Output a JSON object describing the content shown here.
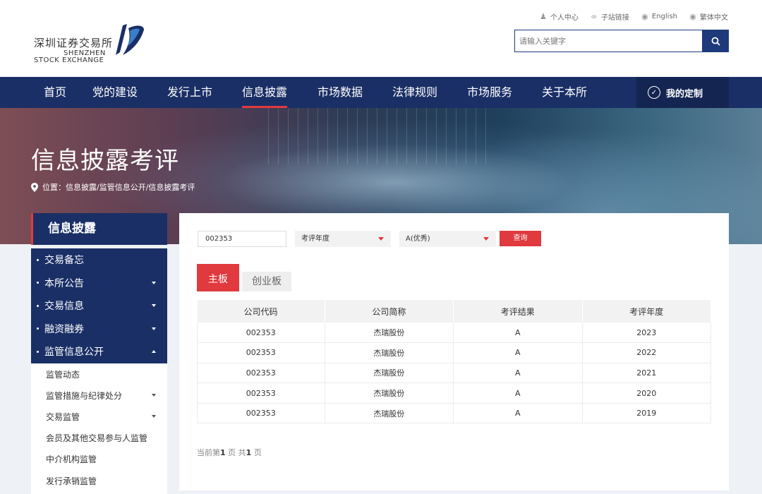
{
  "header": {
    "logo_cn": "深圳证券交易所",
    "logo_en_1": "SHENZHEN",
    "logo_en_2": "STOCK EXCHANGE",
    "top_links": [
      {
        "label": "个人中心",
        "icon": "user-icon"
      },
      {
        "label": "子站链接",
        "icon": "link-icon"
      },
      {
        "label": "English",
        "icon": "globe-icon"
      },
      {
        "label": "繁体中文",
        "icon": "globe-icon"
      }
    ],
    "search_placeholder": "请输入关键字"
  },
  "nav": {
    "items": [
      "首页",
      "党的建设",
      "发行上市",
      "信息披露",
      "市场数据",
      "法律规则",
      "市场服务",
      "关于本所"
    ],
    "active": "信息披露",
    "custom_label": "我的定制"
  },
  "banner": {
    "title": "信息披露考评",
    "breadcrumb": "位置：信息披露/监管信息公开/信息披露考评"
  },
  "sidebar": {
    "title": "信息披露",
    "items": [
      {
        "label": "交易备忘",
        "caret": "none"
      },
      {
        "label": "本所公告",
        "caret": "down"
      },
      {
        "label": "交易信息",
        "caret": "down"
      },
      {
        "label": "融资融券",
        "caret": "down"
      },
      {
        "label": "监管信息公开",
        "caret": "up"
      }
    ],
    "sub_items": [
      {
        "label": "监管动态",
        "caret": false
      },
      {
        "label": "监管措施与纪律处分",
        "caret": true
      },
      {
        "label": "交易监管",
        "caret": true
      },
      {
        "label": "会员及其他交易参与人监管",
        "caret": false
      },
      {
        "label": "中介机构监管",
        "caret": false
      },
      {
        "label": "发行承销监管",
        "caret": false
      }
    ]
  },
  "filters": {
    "code_value": "002353",
    "year_select": "考评年度",
    "result_select": "A(优秀)",
    "query_label": "查询"
  },
  "tabs": {
    "main": "主板",
    "chinext": "创业板"
  },
  "table": {
    "headers": [
      "公司代码",
      "公司简称",
      "考评结果",
      "考评年度"
    ],
    "rows": [
      [
        "002353",
        "杰瑞股份",
        "A",
        "2023"
      ],
      [
        "002353",
        "杰瑞股份",
        "A",
        "2022"
      ],
      [
        "002353",
        "杰瑞股份",
        "A",
        "2021"
      ],
      [
        "002353",
        "杰瑞股份",
        "A",
        "2020"
      ],
      [
        "002353",
        "杰瑞股份",
        "A",
        "2019"
      ]
    ]
  },
  "pager": {
    "prefix": "当前第",
    "current": "1",
    "mid": "页  共",
    "total": "1",
    "suffix": "页"
  },
  "colors": {
    "brand_navy": "#1a2f66",
    "accent_red": "#e03a3e"
  }
}
